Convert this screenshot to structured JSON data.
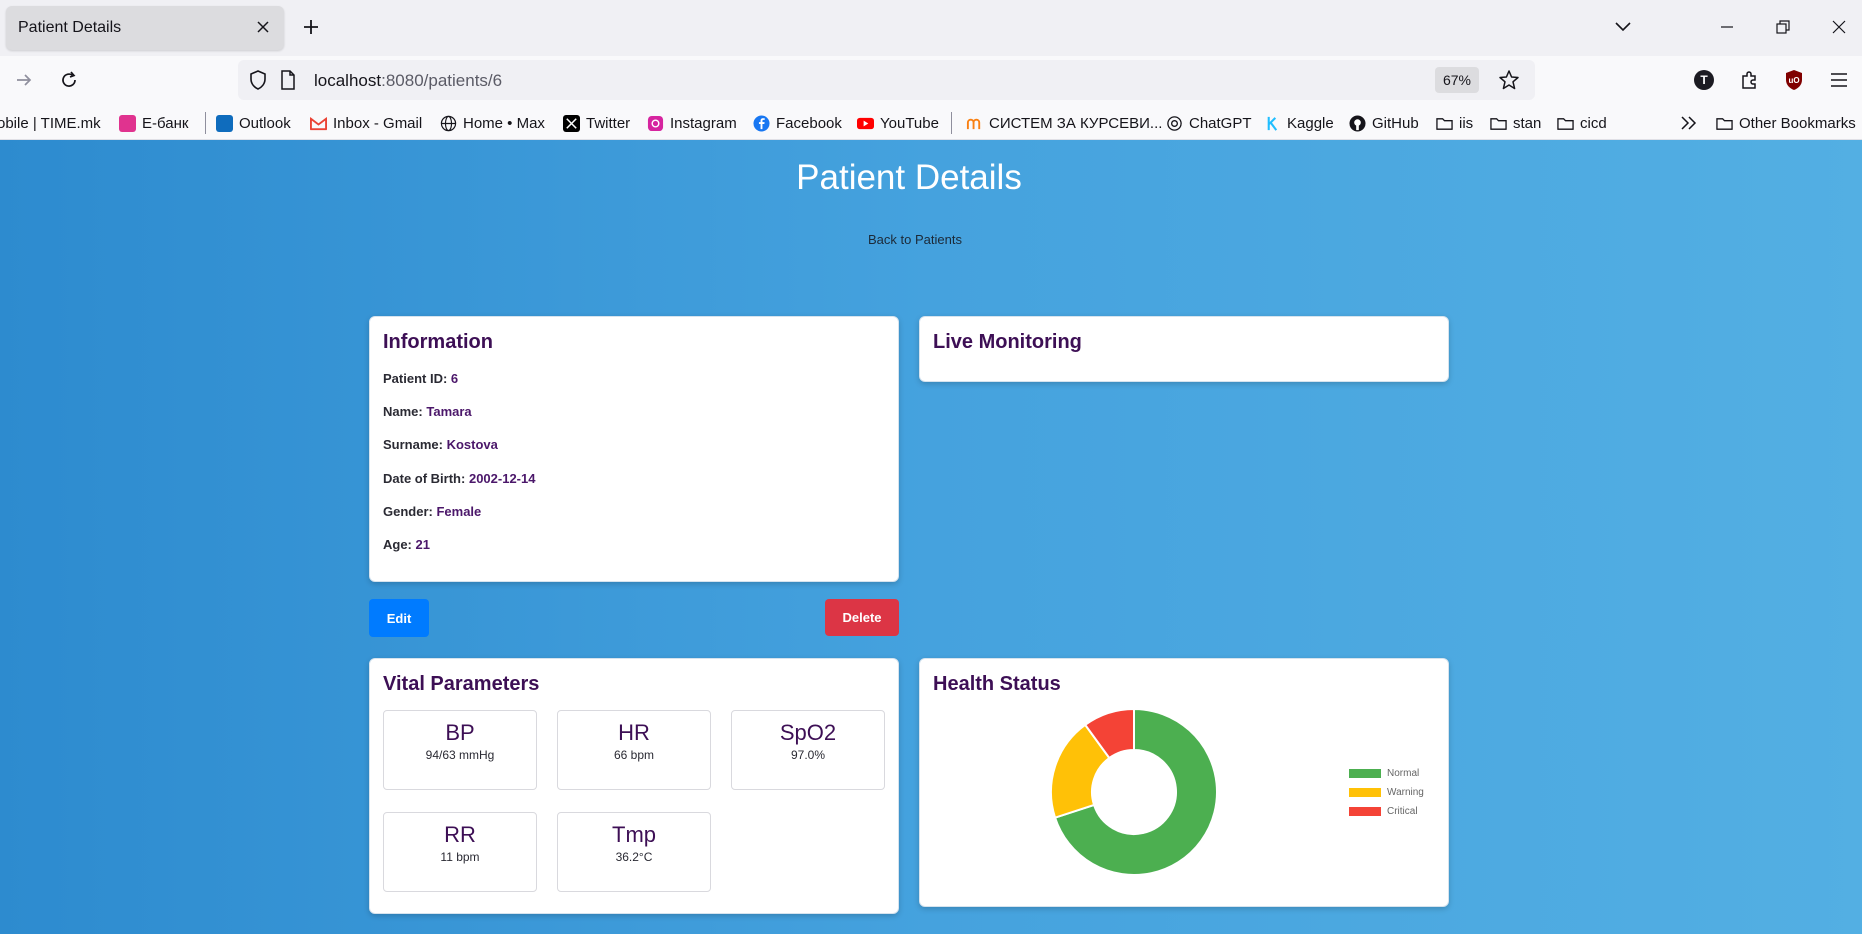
{
  "browser": {
    "tab_title": "Patient Details",
    "url_host": "localhost",
    "url_path": ":8080/patients/6",
    "zoom": "67%",
    "profile_initial": "T",
    "bookmarks": [
      {
        "label": "obile | TIME.mk",
        "icon": "none",
        "color": "#000000"
      },
      {
        "label": "Е-банк",
        "icon": "ebank-icon",
        "color": "#e0338f"
      },
      {
        "label": "Outlook",
        "icon": "outlook-icon",
        "color": "#0f6cbd"
      },
      {
        "label": "Inbox - Gmail",
        "icon": "gmail-icon",
        "color": "#ea4335"
      },
      {
        "label": "Home • Max",
        "icon": "globe-icon",
        "color": "#15141a"
      },
      {
        "label": "Twitter",
        "icon": "x-icon",
        "color": "#000000"
      },
      {
        "label": "Instagram",
        "icon": "instagram-icon",
        "color": "#d6249f"
      },
      {
        "label": "Facebook",
        "icon": "facebook-icon",
        "color": "#1877f2"
      },
      {
        "label": "YouTube",
        "icon": "youtube-icon",
        "color": "#ff0000"
      },
      {
        "label": "СИСТЕМ ЗА КУРСЕВИ...",
        "icon": "moodle-icon",
        "color": "#f98012"
      },
      {
        "label": "ChatGPT",
        "icon": "chatgpt-icon",
        "color": "#15141a"
      },
      {
        "label": "Kaggle",
        "icon": "kaggle-icon",
        "color": "#20beff"
      },
      {
        "label": "GitHub",
        "icon": "github-icon",
        "color": "#15141a"
      },
      {
        "label": "iis",
        "icon": "folder-icon",
        "color": "#15141a"
      },
      {
        "label": "stan",
        "icon": "folder-icon",
        "color": "#15141a"
      },
      {
        "label": "cicd",
        "icon": "folder-icon",
        "color": "#15141a"
      }
    ],
    "other_bookmarks": "Other Bookmarks"
  },
  "page": {
    "title": "Patient Details",
    "back_link": "Back to Patients"
  },
  "information": {
    "heading": "Information",
    "rows": [
      {
        "label": "Patient ID:",
        "value": "6"
      },
      {
        "label": "Name:",
        "value": "Tamara"
      },
      {
        "label": "Surname:",
        "value": "Kostova"
      },
      {
        "label": "Date of Birth:",
        "value": "2002-12-14"
      },
      {
        "label": "Gender:",
        "value": "Female"
      },
      {
        "label": "Age:",
        "value": "21"
      }
    ]
  },
  "actions": {
    "edit": "Edit",
    "delete": "Delete"
  },
  "live_monitoring": {
    "heading": "Live Monitoring"
  },
  "vitals": {
    "heading": "Vital Parameters",
    "items": [
      {
        "name": "BP",
        "value": "94/63 mmHg"
      },
      {
        "name": "HR",
        "value": "66 bpm"
      },
      {
        "name": "SpO2",
        "value": "97.0%"
      },
      {
        "name": "RR",
        "value": "11 bpm"
      },
      {
        "name": "Tmp",
        "value": "36.2°C"
      }
    ]
  },
  "health_status": {
    "heading": "Health Status"
  },
  "colors": {
    "normal": "#4caf50",
    "warning": "#ffc107",
    "critical": "#f44336",
    "heading": "#3d0f55",
    "edit_button": "#007bff",
    "delete_button": "#dc3545"
  },
  "chart_data": {
    "type": "pie",
    "categories": [
      "Normal",
      "Warning",
      "Critical"
    ],
    "values": [
      70,
      20,
      10
    ],
    "colors": [
      "#4caf50",
      "#ffc107",
      "#f44336"
    ],
    "legend": "right"
  }
}
